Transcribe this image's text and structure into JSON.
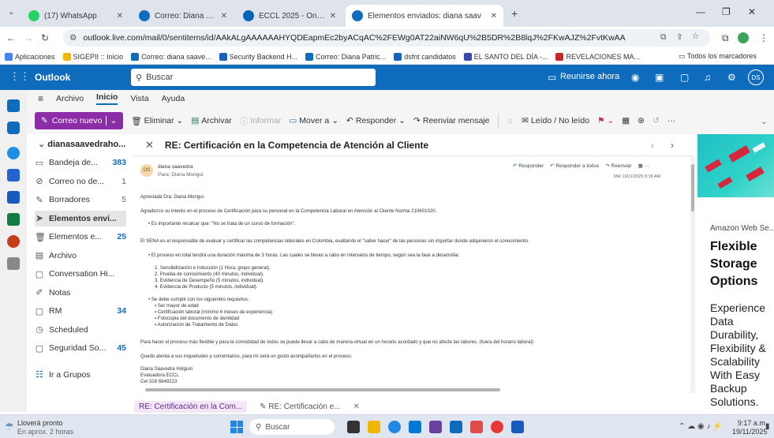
{
  "browser": {
    "tabs": [
      {
        "title": "(17) WhatsApp",
        "color": "#25d366"
      },
      {
        "title": "Correo: Diana Patricia Savedra",
        "color": "#0f6cbd"
      },
      {
        "title": "ECCL 2025 - OneDrive",
        "color": "#0364b8"
      },
      {
        "title": "Elementos enviados: diana saav",
        "color": "#0f6cbd"
      }
    ],
    "new_tab": "+",
    "url": "outlook.live.com/mail/0/sentitems/id/AAkALgAAAAAAHYQDEapmEc2byACqAC%2FEWg0AT22aiNW6qU%2B5DR%2B8lqJ%2FKwAJZ%2FvtKwAA",
    "bookmarks": [
      {
        "label": "Aplicaciones",
        "color": "#4285f4"
      },
      {
        "label": "SIGEPII :: Inicio",
        "color": "#f2b705"
      },
      {
        "label": "Correo: diana saave...",
        "color": "#0f6cbd"
      },
      {
        "label": "Security Backend H...",
        "color": "#1565c0"
      },
      {
        "label": "Correo: Diana Patric...",
        "color": "#0f6cbd"
      },
      {
        "label": "dsfnt candidatos",
        "color": "#1565c0"
      },
      {
        "label": "EL SANTO DEL DÍA -...",
        "color": "#3949ab"
      },
      {
        "label": "REVELACIONES MA...",
        "color": "#c62828"
      }
    ],
    "all_bookmarks": "Todos los marcadores"
  },
  "outlook": {
    "brand": "Outlook",
    "search_placeholder": "Buscar",
    "meet_now": "Reunirse ahora",
    "avatar": "DS",
    "ribbon_tabs": [
      "Archivo",
      "Inicio",
      "Vista",
      "Ayuda"
    ],
    "ribbon": {
      "new_mail": "Correo nuevo",
      "delete": "Eliminar",
      "archive": "Archivar",
      "report": "Informar",
      "move": "Mover a",
      "reply": "Responder",
      "forward": "Reenviar mensaje",
      "read_unread": "Leído / No leído",
      "more": "···"
    },
    "account": "dianasaavedraho...",
    "folders": [
      {
        "name": "Bandeja de...",
        "count": "383",
        "icon": "inbox-icon",
        "glyph": "▭",
        "style": "bold"
      },
      {
        "name": "Correo no de...",
        "count": "1",
        "icon": "junk-icon",
        "glyph": "⊘",
        "style": "plain"
      },
      {
        "name": "Borradores",
        "count": "5",
        "icon": "drafts-icon",
        "glyph": "✎",
        "style": "plain"
      },
      {
        "name": "Elementos envi...",
        "count": "",
        "icon": "sent-icon",
        "glyph": "➤",
        "style": "selected"
      },
      {
        "name": "Elementos e...",
        "count": "25",
        "icon": "deleted-icon",
        "glyph": "🗑",
        "style": "bold"
      },
      {
        "name": "Archivo",
        "count": "",
        "icon": "archive-icon",
        "glyph": "▤",
        "style": "plain"
      },
      {
        "name": "Conversation Hi...",
        "count": "",
        "icon": "folder-icon",
        "glyph": "▢",
        "style": "plain"
      },
      {
        "name": "Notas",
        "count": "",
        "icon": "notes-icon",
        "glyph": "✐",
        "style": "plain"
      },
      {
        "name": "RM",
        "count": "34",
        "icon": "folder-icon",
        "glyph": "▢",
        "style": "bold"
      },
      {
        "name": "Scheduled",
        "count": "",
        "icon": "clock-icon",
        "glyph": "◷",
        "style": "plain"
      },
      {
        "name": "Seguridad So...",
        "count": "45",
        "icon": "folder-icon",
        "glyph": "▢",
        "style": "bold"
      },
      {
        "name": "Ir a Grupos",
        "count": "",
        "icon": "groups-icon",
        "glyph": "☷",
        "style": "link"
      }
    ],
    "message": {
      "subject": "RE: Certificación en la Competencia de Atención al Cliente",
      "sender": "diana saavedra",
      "sender_initials": "DS",
      "to": "Para: Diana Mongui",
      "actions": [
        "Responder",
        "Responder a todos",
        "Reenviar"
      ],
      "date": "Mié 19/11/2025 9:18 AM",
      "body": [
        {
          "text": "Apreciada Dra. Diana Mongui",
          "indent": 0
        },
        {
          "text": "Agradezco su interés en el proceso de Certificación para su personal en la Competencia Laboral en Atención al Cliente Norma 210601020.",
          "indent": 0
        },
        {
          "text": "• Es importante recalcar que: \"No se trata de un curso de formación\".",
          "indent": 1
        },
        {
          "text": "El SENA es el responsable de evaluar y certificar las competencias laborales en Colombia, exaltando el \"saber hacer\" de las personas sin importar donde adquirieron el conocimiento.",
          "indent": 0
        },
        {
          "text": "• El proceso en total tendrá una duración máxima de 3 horas.  Las cuales se llevan a cabo en intervalos de tiempo, según sea la fase a desarrollar.",
          "indent": 1
        },
        {
          "text": "1.  Sensibilización e Inducción (1 Hora, grupo general).",
          "indent": 2
        },
        {
          "text": "2.  Prueba de conocimiento (40 minutos, individual).",
          "indent": 2
        },
        {
          "text": "3.  Evidencia de Desempeño (5 minutos, individual).",
          "indent": 2
        },
        {
          "text": "4.  Evidencia de Producto (5 minutos, individual).",
          "indent": 2
        },
        {
          "text": "• Se debe cumplir con los siguientes requisitos:",
          "indent": 1
        },
        {
          "text": "▪ Ser mayor de edad",
          "indent": 2
        },
        {
          "text": "▪ Certificación laboral (mínimo 6 meses de experiencia)",
          "indent": 2
        },
        {
          "text": "▪ Fotocopia del documento de identidad",
          "indent": 2
        },
        {
          "text": "▪ Autorización de Tratamiento de Datos",
          "indent": 2
        },
        {
          "text": "Para hacer el proceso más flexible y para la comodidad de todos se puede llevar a cabo de manera virtual en un horario acordado y que no afecte las labores. (fuera del horario laboral)",
          "indent": 0
        },
        {
          "text": "Quedo atenta a sus inquietudes y comentarios, para mí será un gusto acompañarlos en el proceso.",
          "indent": 0
        },
        {
          "text": "Diana Saavedra Holguín",
          "indent": 0
        },
        {
          "text": "Evaluadora ECCL",
          "indent": 0
        },
        {
          "text": "Cel 316 6649223",
          "indent": 0
        }
      ]
    },
    "draft_tabs": [
      "RE: Certificación en la Com...",
      "RE: Certificación e..."
    ],
    "ad": {
      "brand": "Amazon Web Se...",
      "headline": "Flexible Storage Options",
      "body": "Experience Data Durability, Flexibility & Scalability With Easy Backup Solutions."
    }
  },
  "taskbar": {
    "weather_title": "Lloverá pronto",
    "weather_sub": "En aprox. 2 horas",
    "search_placeholder": "Buscar",
    "time": "9:17 a.m.",
    "date": "19/11/2025"
  }
}
